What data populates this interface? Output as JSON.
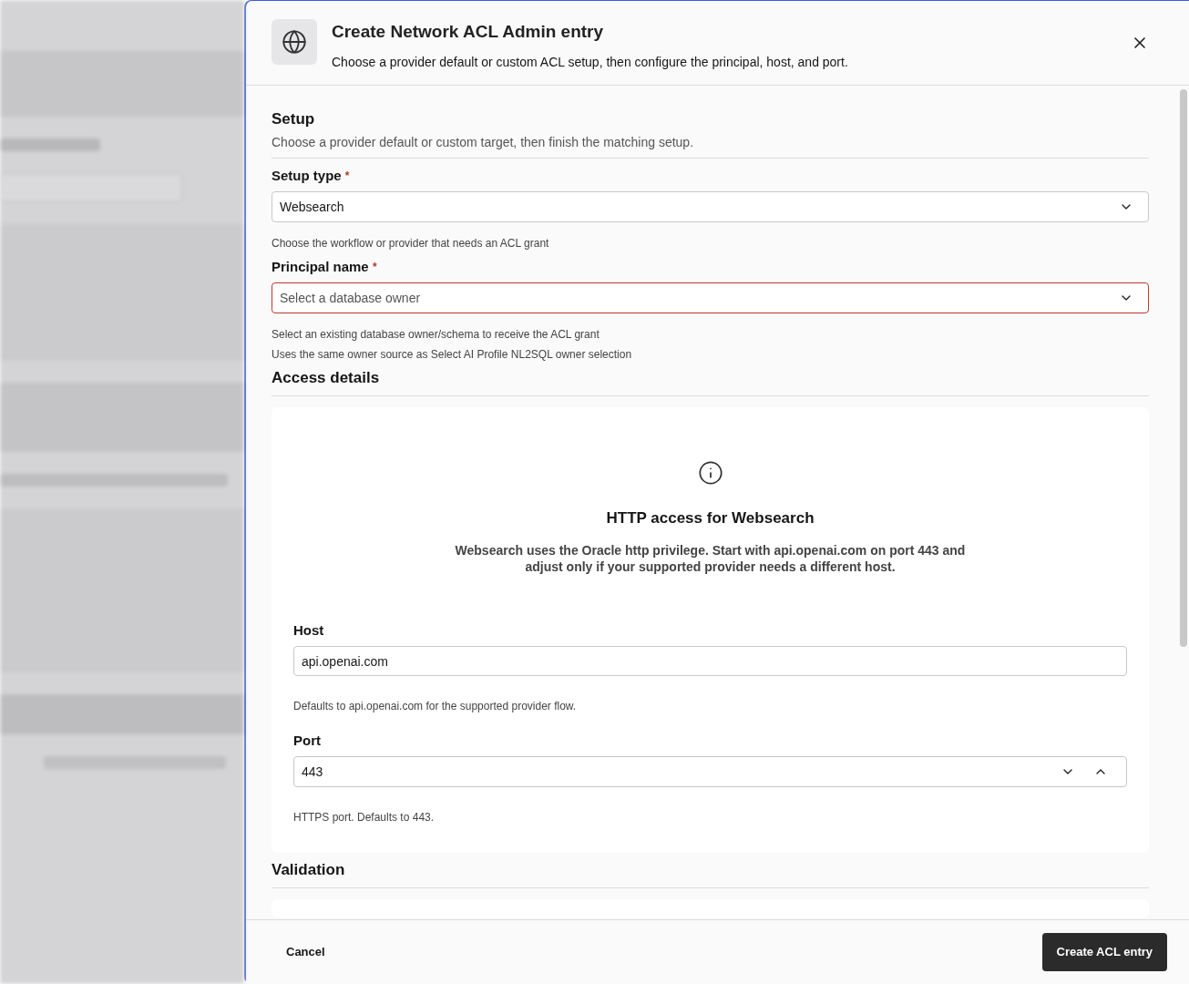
{
  "dialog": {
    "title": "Create Network ACL Admin entry",
    "subtitle": "Choose a provider default or custom ACL setup, then configure the principal, host, and port."
  },
  "setup": {
    "heading": "Setup",
    "description": "Choose a provider default or custom target, then finish the matching setup.",
    "fields": [
      {
        "label": "Setup type",
        "required": "*",
        "value": "Websearch",
        "help": [
          "Choose the workflow or provider that needs an ACL grant"
        ],
        "invalid": false
      },
      {
        "label": "Principal name",
        "required": "*",
        "placeholder": "Select a database owner",
        "help": [
          "Select an existing database owner/schema to receive the ACL grant",
          "Uses the same owner source as Select AI Profile NL2SQL owner selection"
        ],
        "invalid": true
      }
    ]
  },
  "access": {
    "heading": "Access details",
    "notice_title": "HTTP access for Websearch",
    "notice_text": "Websearch uses the Oracle http privilege. Start with api.openai.com on port 443 and adjust only if your supported provider needs a different host.",
    "host": {
      "label": "Host",
      "value": "api.openai.com",
      "help": "Defaults to api.openai.com for the supported provider flow."
    },
    "port": {
      "label": "Port",
      "value": "443",
      "help": "HTTPS port. Defaults to 443."
    }
  },
  "validation": {
    "heading": "Validation"
  },
  "footer": {
    "cancel": "Cancel",
    "submit": "Create ACL entry"
  }
}
